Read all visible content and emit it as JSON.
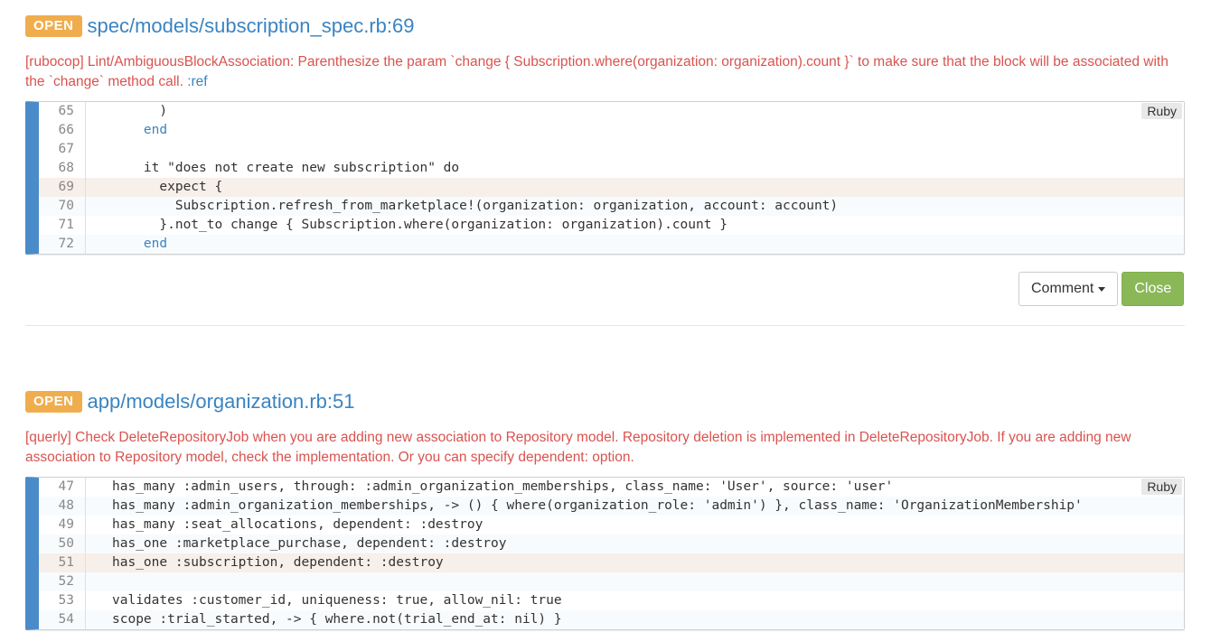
{
  "issues": [
    {
      "status": "OPEN",
      "file": "spec/models/subscription_spec.rb:69",
      "message_prefix": "[rubocop] Lint/AmbiguousBlockAssociation: Parenthesize the param `change { Subscription.where(organization: organization).count }` to make sure that the block will be associated with the `change` method call.",
      "message_ref": ":ref",
      "language": "Ruby",
      "lines": [
        {
          "n": "65",
          "code": "      )"
        },
        {
          "n": "66",
          "code": "    end"
        },
        {
          "n": "67",
          "code": ""
        },
        {
          "n": "68",
          "code": "    it \"does not create new subscription\" do"
        },
        {
          "n": "69",
          "code": "      expect {"
        },
        {
          "n": "70",
          "code": "        Subscription.refresh_from_marketplace!(organization: organization, account: account)"
        },
        {
          "n": "71",
          "code": "      }.not_to change { Subscription.where(organization: organization).count }"
        },
        {
          "n": "72",
          "code": "    end"
        }
      ]
    },
    {
      "status": "OPEN",
      "file": "app/models/organization.rb:51",
      "message": "[querly] Check DeleteRepositoryJob when you are adding new association to Repository model. Repository deletion is implemented in DeleteRepositoryJob. If you are adding new association to Repository model, check the implementation. Or you can specify dependent: option.",
      "language": "Ruby",
      "lines": [
        {
          "n": "47",
          "code": "has_many :admin_users, through: :admin_organization_memberships, class_name: 'User', source: 'user'"
        },
        {
          "n": "48",
          "code": "has_many :admin_organization_memberships, -> () { where(organization_role: 'admin') }, class_name: 'OrganizationMembership'"
        },
        {
          "n": "49",
          "code": "has_many :seat_allocations, dependent: :destroy"
        },
        {
          "n": "50",
          "code": "has_one :marketplace_purchase, dependent: :destroy"
        },
        {
          "n": "51",
          "code": "has_one :subscription, dependent: :destroy"
        },
        {
          "n": "52",
          "code": ""
        },
        {
          "n": "53",
          "code": "validates :customer_id, uniqueness: true, allow_nil: true"
        },
        {
          "n": "54",
          "code": "scope :trial_started, -> { where.not(trial_end_at: nil) }"
        }
      ]
    }
  ],
  "actions": {
    "comment_label": "Comment",
    "close_label": "Close"
  },
  "colors": {
    "badge": "#f0ad4e",
    "link": "#3a84c1",
    "message": "#d9534f",
    "gutter": "#4a8bc9",
    "close_button": "#8ab857"
  }
}
